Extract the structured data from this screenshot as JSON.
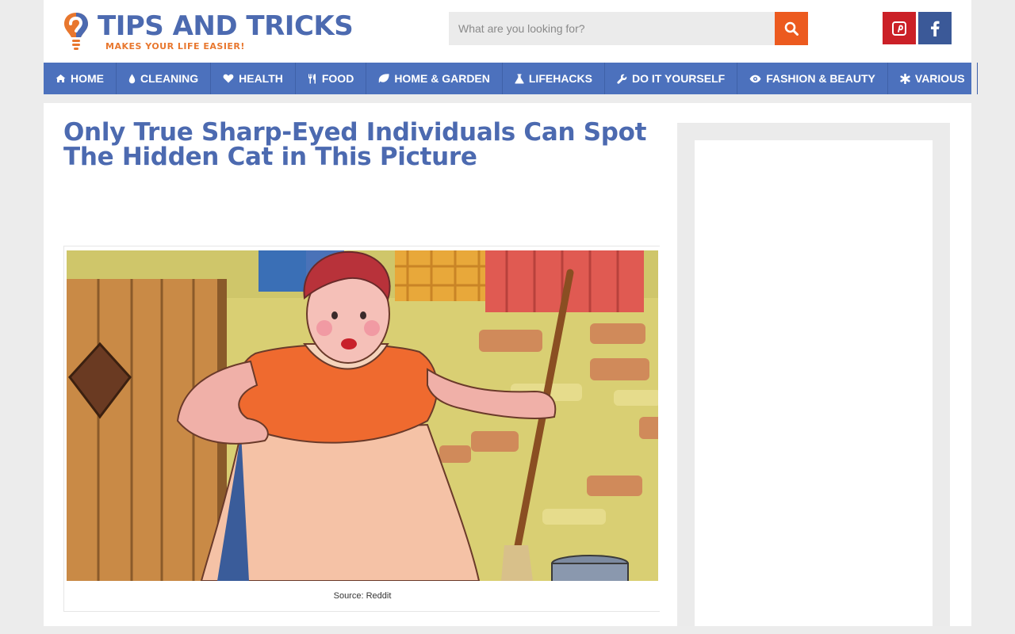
{
  "brand": {
    "title": "TIPS AND TRICKS",
    "tagline": "MAKES YOUR LIFE EASIER!"
  },
  "search": {
    "placeholder": "What are you looking for?"
  },
  "social": {
    "pinterest_icon": "pinterest-icon",
    "facebook_icon": "facebook-icon"
  },
  "nav": {
    "items": [
      {
        "label": "HOME",
        "icon": "home-icon"
      },
      {
        "label": "CLEANING",
        "icon": "drop-icon"
      },
      {
        "label": "HEALTH",
        "icon": "heart-icon"
      },
      {
        "label": "FOOD",
        "icon": "cutlery-icon"
      },
      {
        "label": "HOME & GARDEN",
        "icon": "leaf-icon"
      },
      {
        "label": "LIFEHACKS",
        "icon": "flask-icon"
      },
      {
        "label": "DO IT YOURSELF",
        "icon": "wrench-icon"
      },
      {
        "label": "FASHION & BEAUTY",
        "icon": "eye-icon"
      },
      {
        "label": "VARIOUS",
        "icon": "asterisk-icon"
      }
    ]
  },
  "article": {
    "title": "Only True Sharp-Eyed Individuals Can Spot The Hidden Cat in This Picture",
    "caption": "Source: Reddit"
  },
  "colors": {
    "brand_blue": "#4c6ab0",
    "nav_blue": "#4c71bd",
    "accent_orange": "#ec5a1f",
    "pinterest_red": "#cb2027",
    "facebook_blue": "#3b5998"
  }
}
